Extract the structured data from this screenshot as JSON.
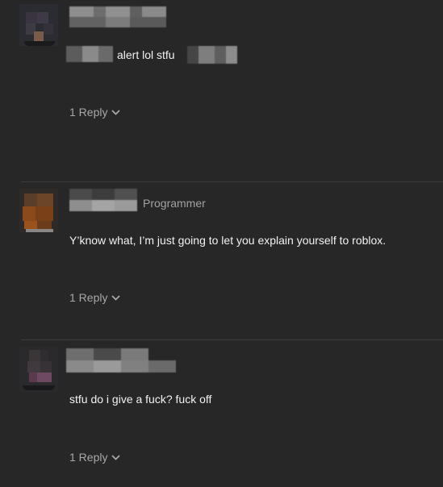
{
  "comments": [
    {
      "text_suffix": "alert lol stfu",
      "reply_label": "1 Reply"
    },
    {
      "role": "Programmer",
      "text": "Y’know what, I’m just going to let you explain yourself to roblox.",
      "reply_label": "1 Reply"
    },
    {
      "text": "stfu do i give a fuck? fuck off",
      "reply_label": "1 Reply"
    }
  ],
  "icons": {
    "reply_chevron": "chevron-down-icon"
  },
  "colors": {
    "background": "#272727",
    "divider": "#3c3c3c",
    "text": "#f2f2f2",
    "muted": "#a8a8a8"
  }
}
